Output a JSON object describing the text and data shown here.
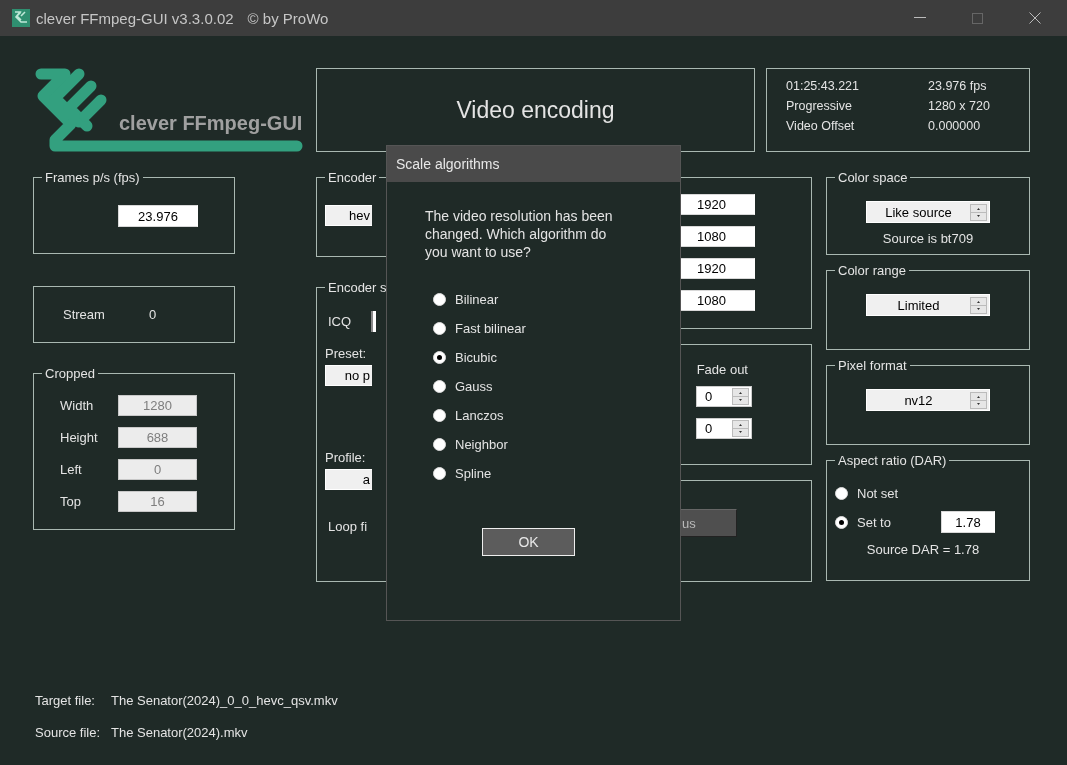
{
  "window": {
    "title": "clever FFmpeg-GUI v3.3.0.02",
    "copyright": "© by ProWo"
  },
  "logo": {
    "text": "clever FFmpeg-GUI"
  },
  "header": {
    "title": "Video encoding"
  },
  "source_info": [
    {
      "label": "01:25:43.221",
      "value": "23.976 fps"
    },
    {
      "label": "Progressive",
      "value": "1280 x 720"
    },
    {
      "label": "Video Offset",
      "value": "0.000000"
    }
  ],
  "frames": {
    "legend": "Frames p/s (fps)",
    "value": "23.976"
  },
  "stream": {
    "label": "Stream",
    "value": "0"
  },
  "cropped": {
    "legend": "Cropped",
    "fields": [
      {
        "label": "Width",
        "value": "1280",
        "disabled": true
      },
      {
        "label": "Height",
        "value": "688",
        "disabled": true
      },
      {
        "label": "Left",
        "value": "0",
        "disabled": true
      },
      {
        "label": "Top",
        "value": "16",
        "disabled": true
      }
    ]
  },
  "encoder": {
    "legend": "Encoder",
    "button": "hev"
  },
  "sizes": [
    "1920",
    "1080",
    "1920",
    "1080"
  ],
  "encoder_settings": {
    "legend": "Encoder s",
    "icq_label": "ICQ",
    "preset_label": "Preset:",
    "preset": "no p",
    "profile_label": "Profile:",
    "profile": "a",
    "loop_label": "Loop fi"
  },
  "fade": {
    "label": "Fade out",
    "values": [
      "0",
      "0"
    ]
  },
  "button_3": "us",
  "color_space": {
    "legend": "Color space",
    "value": "Like source",
    "note": "Source is bt709"
  },
  "color_range": {
    "legend": "Color range",
    "value": "Limited"
  },
  "pixel_format": {
    "legend": "Pixel format",
    "value": "nv12"
  },
  "aspect_ratio": {
    "legend": "Aspect ratio (DAR)",
    "options": [
      {
        "label": "Not set",
        "selected": false
      },
      {
        "label": "Set to",
        "selected": true
      }
    ],
    "value": "1.78",
    "note": "Source DAR = 1.78"
  },
  "files": [
    {
      "label": "Target file:",
      "value": "The Senator(2024)_0_0_hevc_qsv.mkv"
    },
    {
      "label": "Source file:",
      "value": "The Senator(2024).mkv"
    }
  ],
  "dialog": {
    "title": "Scale algorithms",
    "message": "The video resolution has been changed. Which algorithm do you want to use?",
    "options": [
      {
        "label": "Bilinear",
        "selected": false
      },
      {
        "label": "Fast bilinear",
        "selected": false
      },
      {
        "label": "Bicubic",
        "selected": true
      },
      {
        "label": "Gauss",
        "selected": false
      },
      {
        "label": "Lanczos",
        "selected": false
      },
      {
        "label": "Neighbor",
        "selected": false
      },
      {
        "label": "Spline",
        "selected": false
      }
    ],
    "ok": "OK"
  }
}
